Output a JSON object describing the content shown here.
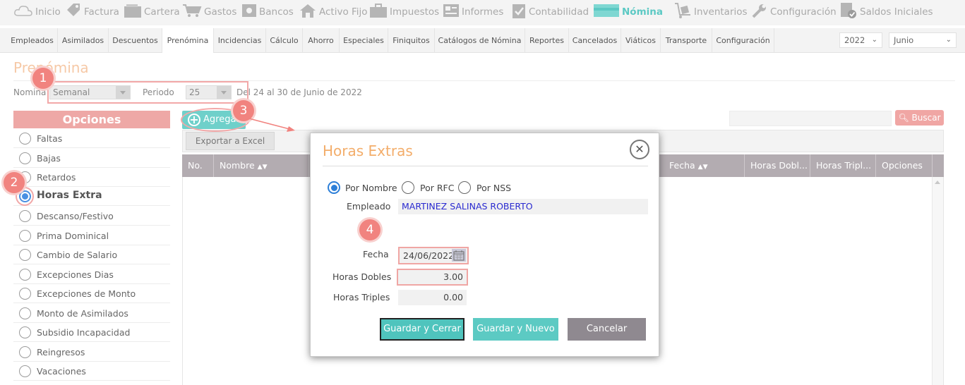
{
  "top_menu": [
    {
      "label": "Inicio",
      "icon": "cloud-icon"
    },
    {
      "label": "Factura",
      "icon": "tag-icon"
    },
    {
      "label": "Cartera",
      "icon": "wallet-icon"
    },
    {
      "label": "Gastos",
      "icon": "cart-icon"
    },
    {
      "label": "Bancos",
      "icon": "safe-icon"
    },
    {
      "label": "Activo Fijo",
      "icon": "house-icon"
    },
    {
      "label": "Impuestos",
      "icon": "briefcase-icon"
    },
    {
      "label": "Informes",
      "icon": "newspaper-icon"
    },
    {
      "label": "Contabilidad",
      "icon": "clipboard-check-icon"
    },
    {
      "label": "Nómina",
      "icon": "card-icon"
    },
    {
      "label": "Inventarios",
      "icon": "dolly-icon"
    },
    {
      "label": "Configuración",
      "icon": "wrench-icon"
    },
    {
      "label": "Saldos Iniciales",
      "icon": "document-check-icon"
    }
  ],
  "sub_menu": [
    "Empleados",
    "Asimilados",
    "Descuentos",
    "Prenómina",
    "Incidencias",
    "Cálculo",
    "Ahorro",
    "Especiales",
    "Finiquitos",
    "Catálogos de Nómina",
    "Reportes",
    "Cancelados",
    "Viáticos",
    "Transporte",
    "Configuración"
  ],
  "year_select": "2022",
  "month_select": "Junio",
  "page_title": "Prenómina",
  "filter": {
    "nomina_label": "Nomina",
    "nomina_value": "Semanal",
    "periodo_label": "Periodo",
    "periodo_value": "25",
    "period_text": "Del 24 al 30 de Junio de 2022"
  },
  "options_header": "Opciones",
  "options": [
    "Faltas",
    "Bajas",
    "Retardos",
    "Horas Extra",
    "Descanso/Festivo",
    "Prima Dominical",
    "Cambio de Salario",
    "Excepciones Dias",
    "Excepciones de Monto",
    "Monto de Asimilados",
    "Subsidio Incapacidad",
    "Reingresos",
    "Vacaciones"
  ],
  "selected_option": "Horas Extra",
  "toolbar": {
    "add_label": "Agregar",
    "export_label": "Exportar a Excel",
    "search_label": "Buscar"
  },
  "grid_columns": [
    "No.",
    "Nombre",
    "Fecha",
    "Horas Dobl...",
    "Horas Tripl...",
    "Opciones"
  ],
  "badges": [
    "1",
    "2",
    "3",
    "4"
  ],
  "dialog": {
    "title": "Horas Extras",
    "search_by": [
      "Por Nombre",
      "Por RFC",
      "Por NSS"
    ],
    "search_by_selected": "Por Nombre",
    "empleado_label": "Empleado",
    "empleado_value": "MARTINEZ SALINAS ROBERTO",
    "fecha_label": "Fecha",
    "fecha_value": "24/06/2022",
    "horas_dobles_label": "Horas Dobles",
    "horas_dobles_value": "3.00",
    "horas_triples_label": "Horas Triples",
    "horas_triples_value": "0.00",
    "save_close_label": "Guardar y Cerrar",
    "save_new_label": "Guardar y Nuevo",
    "cancel_label": "Cancelar"
  },
  "colors": {
    "accent": "#5cc9c4",
    "title": "#f6c9a7",
    "highlight": "#f1837f",
    "dialog_title": "#f3ad6a",
    "cancel": "#8f8990"
  }
}
